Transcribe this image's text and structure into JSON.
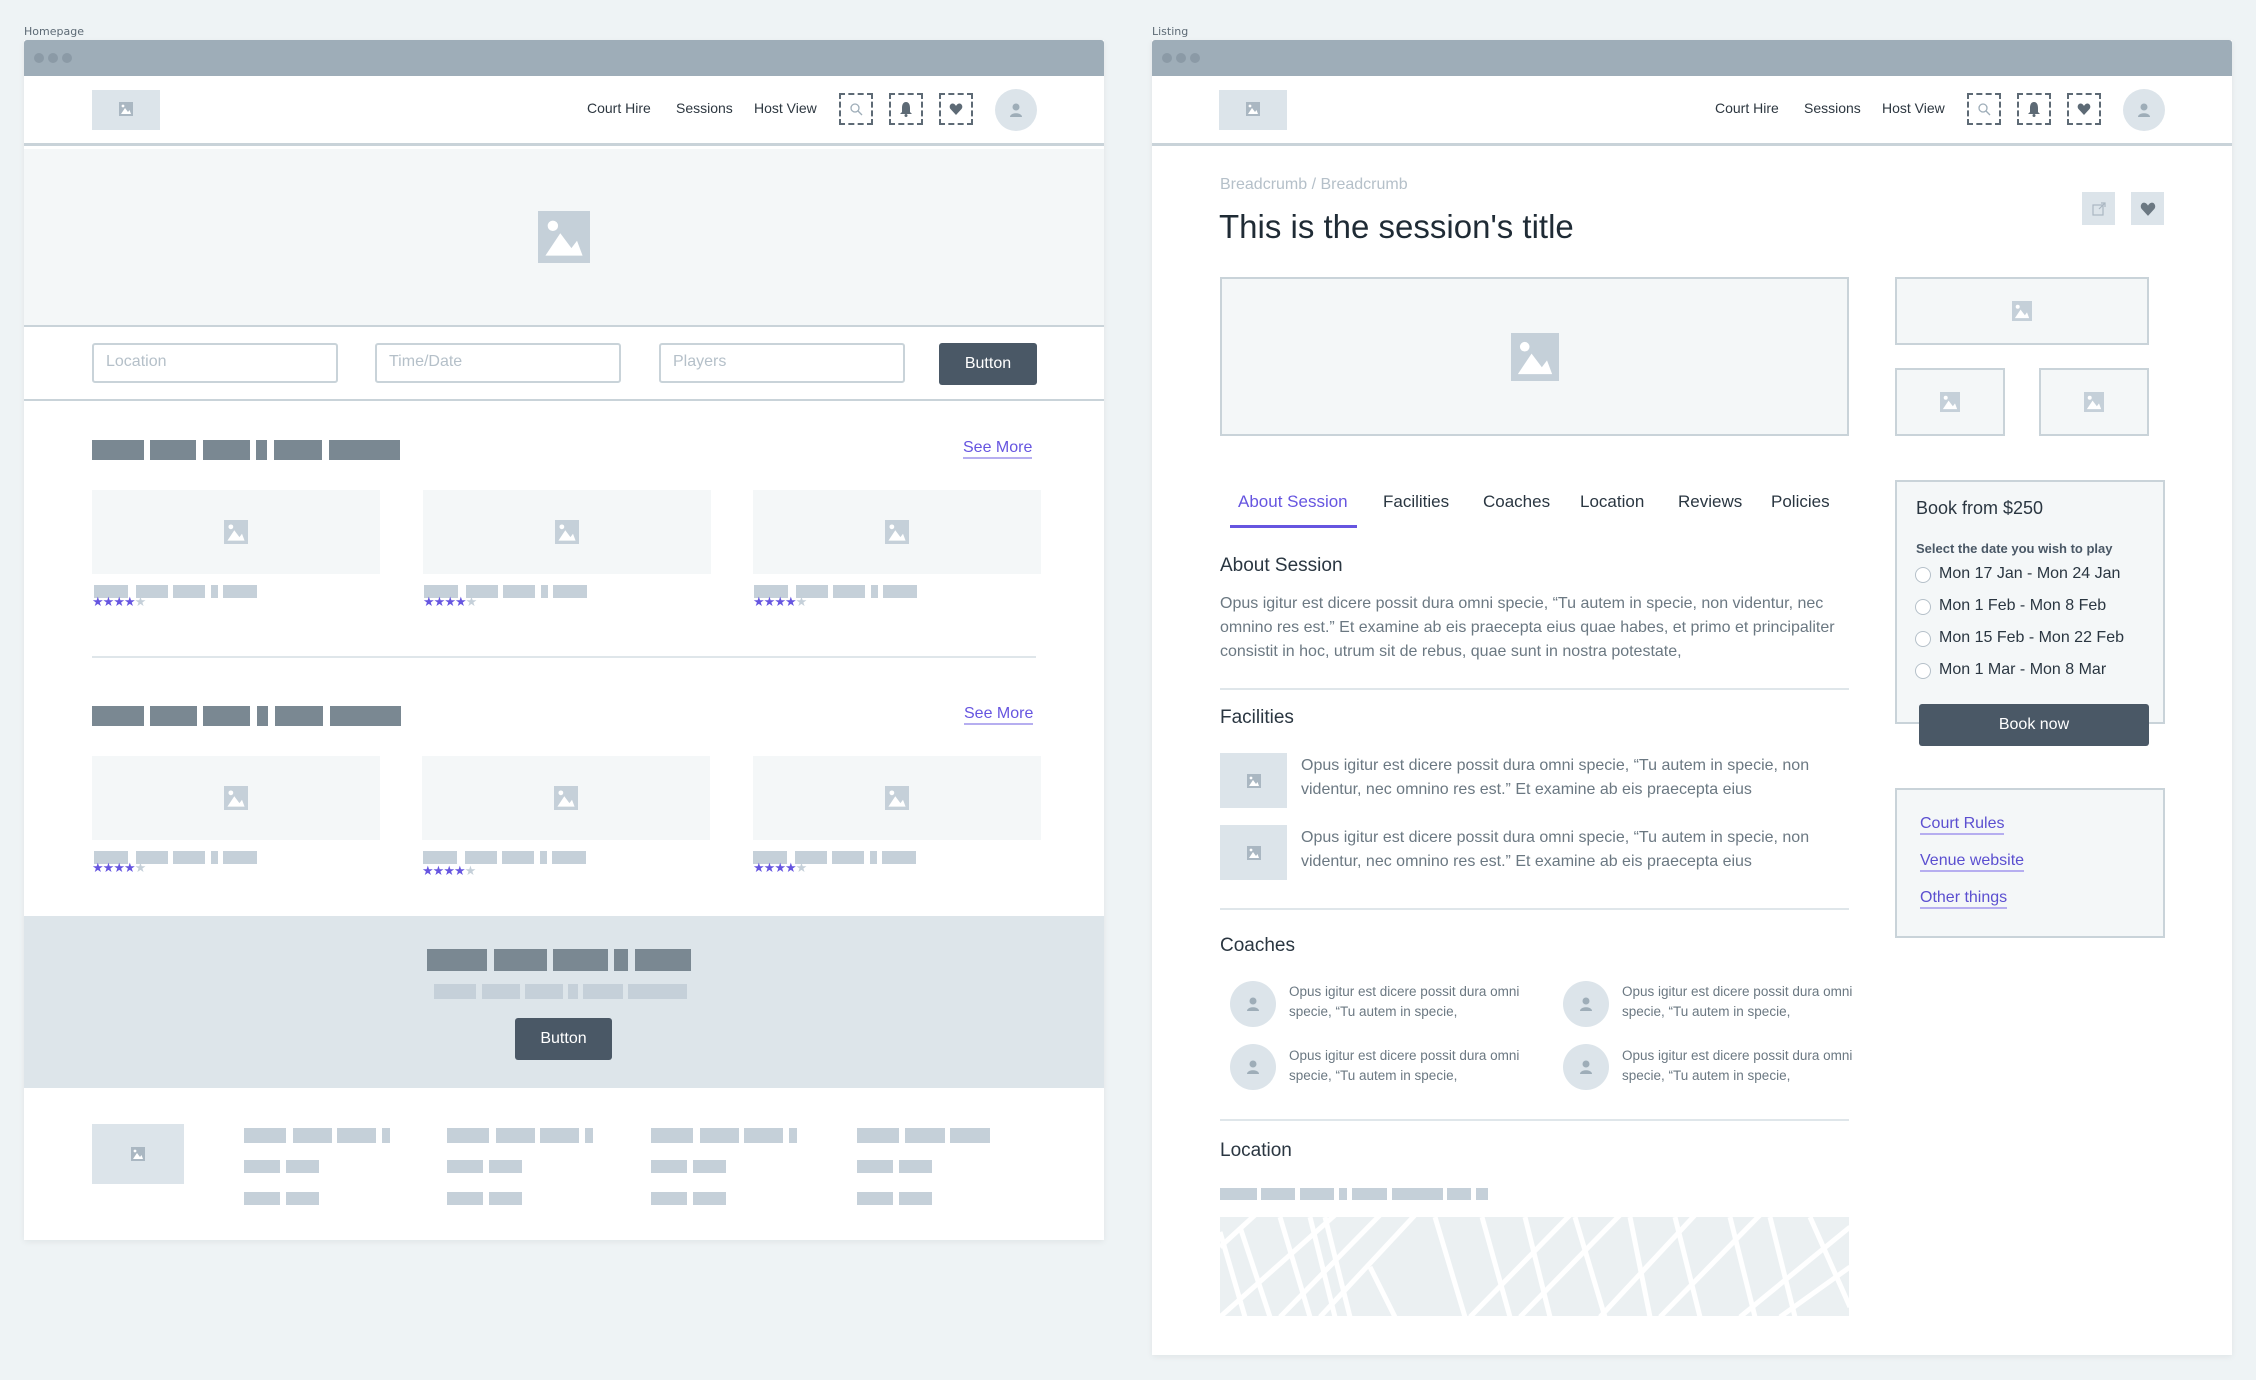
{
  "homepage": {
    "frame_label": "Homepage",
    "nav": {
      "links": [
        "Court Hire",
        "Sessions",
        "Host View"
      ],
      "icons": [
        "search-icon",
        "bell-icon",
        "heart-icon"
      ],
      "avatar": "user-avatar"
    },
    "search": {
      "location_placeholder": "Location",
      "time_placeholder": "Time/Date",
      "players_placeholder": "Players",
      "button_label": "Button"
    },
    "sections": [
      {
        "see_more": "See More",
        "cards": [
          {
            "rating": 4,
            "max": 5
          },
          {
            "rating": 4,
            "max": 5
          },
          {
            "rating": 4,
            "max": 5
          }
        ]
      },
      {
        "see_more": "See More",
        "cards": [
          {
            "rating": 4,
            "max": 5
          },
          {
            "rating": 4,
            "max": 5
          },
          {
            "rating": 4,
            "max": 5
          }
        ]
      }
    ],
    "banner": {
      "button_label": "Button"
    }
  },
  "listing": {
    "frame_label": "Listing",
    "nav": {
      "links": [
        "Court Hire",
        "Sessions",
        "Host View"
      ]
    },
    "breadcrumb": "Breadcrumb / Breadcrumb",
    "title": "This is the session's title",
    "tabs": [
      {
        "label": "About Session",
        "active": true
      },
      {
        "label": "Facilities",
        "active": false
      },
      {
        "label": "Coaches",
        "active": false
      },
      {
        "label": "Location",
        "active": false
      },
      {
        "label": "Reviews",
        "active": false
      },
      {
        "label": "Policies",
        "active": false
      }
    ],
    "about": {
      "heading": "About Session",
      "text": "Opus igitur est dicere possit dura omni specie, “Tu autem in specie, non videntur, nec omnino res est.” Et examine ab eis praecepta eius quae habes, et primo et principaliter consistit in hoc, utrum sit de rebus, quae sunt in nostra potestate,"
    },
    "facilities": {
      "heading": "Facilities",
      "items": [
        "Opus igitur est dicere possit dura omni specie, “Tu autem in specie, non videntur, nec omnino res est.” Et examine ab eis praecepta eius",
        "Opus igitur est dicere possit dura omni specie, “Tu autem in specie, non videntur, nec omnino res est.” Et examine ab eis praecepta eius"
      ]
    },
    "coaches": {
      "heading": "Coaches",
      "items": [
        "Opus igitur est dicere possit dura omni specie, “Tu autem in specie,",
        "Opus igitur est dicere possit dura omni specie, “Tu autem in specie,",
        "Opus igitur est dicere possit dura omni specie, “Tu autem in specie,",
        "Opus igitur est dicere possit dura omni specie, “Tu autem in specie,"
      ]
    },
    "location": {
      "heading": "Location"
    },
    "booking": {
      "title": "Book from $250",
      "prompt": "Select the date you wish to play",
      "options": [
        "Mon 17 Jan - Mon 24 Jan",
        "Mon 1 Feb - Mon 8 Feb",
        "Mon 15 Feb - Mon 22 Feb",
        "Mon 1 Mar - Mon 8 Mar"
      ],
      "button_label": "Book now"
    },
    "links": [
      "Court Rules",
      "Venue website",
      "Other things"
    ]
  },
  "colors": {
    "accent": "#6655e0",
    "button": "#4a5866",
    "topbar": "#9eadb8",
    "placeholder_block": "#c5d0d9",
    "heading_block": "#7a8892"
  }
}
